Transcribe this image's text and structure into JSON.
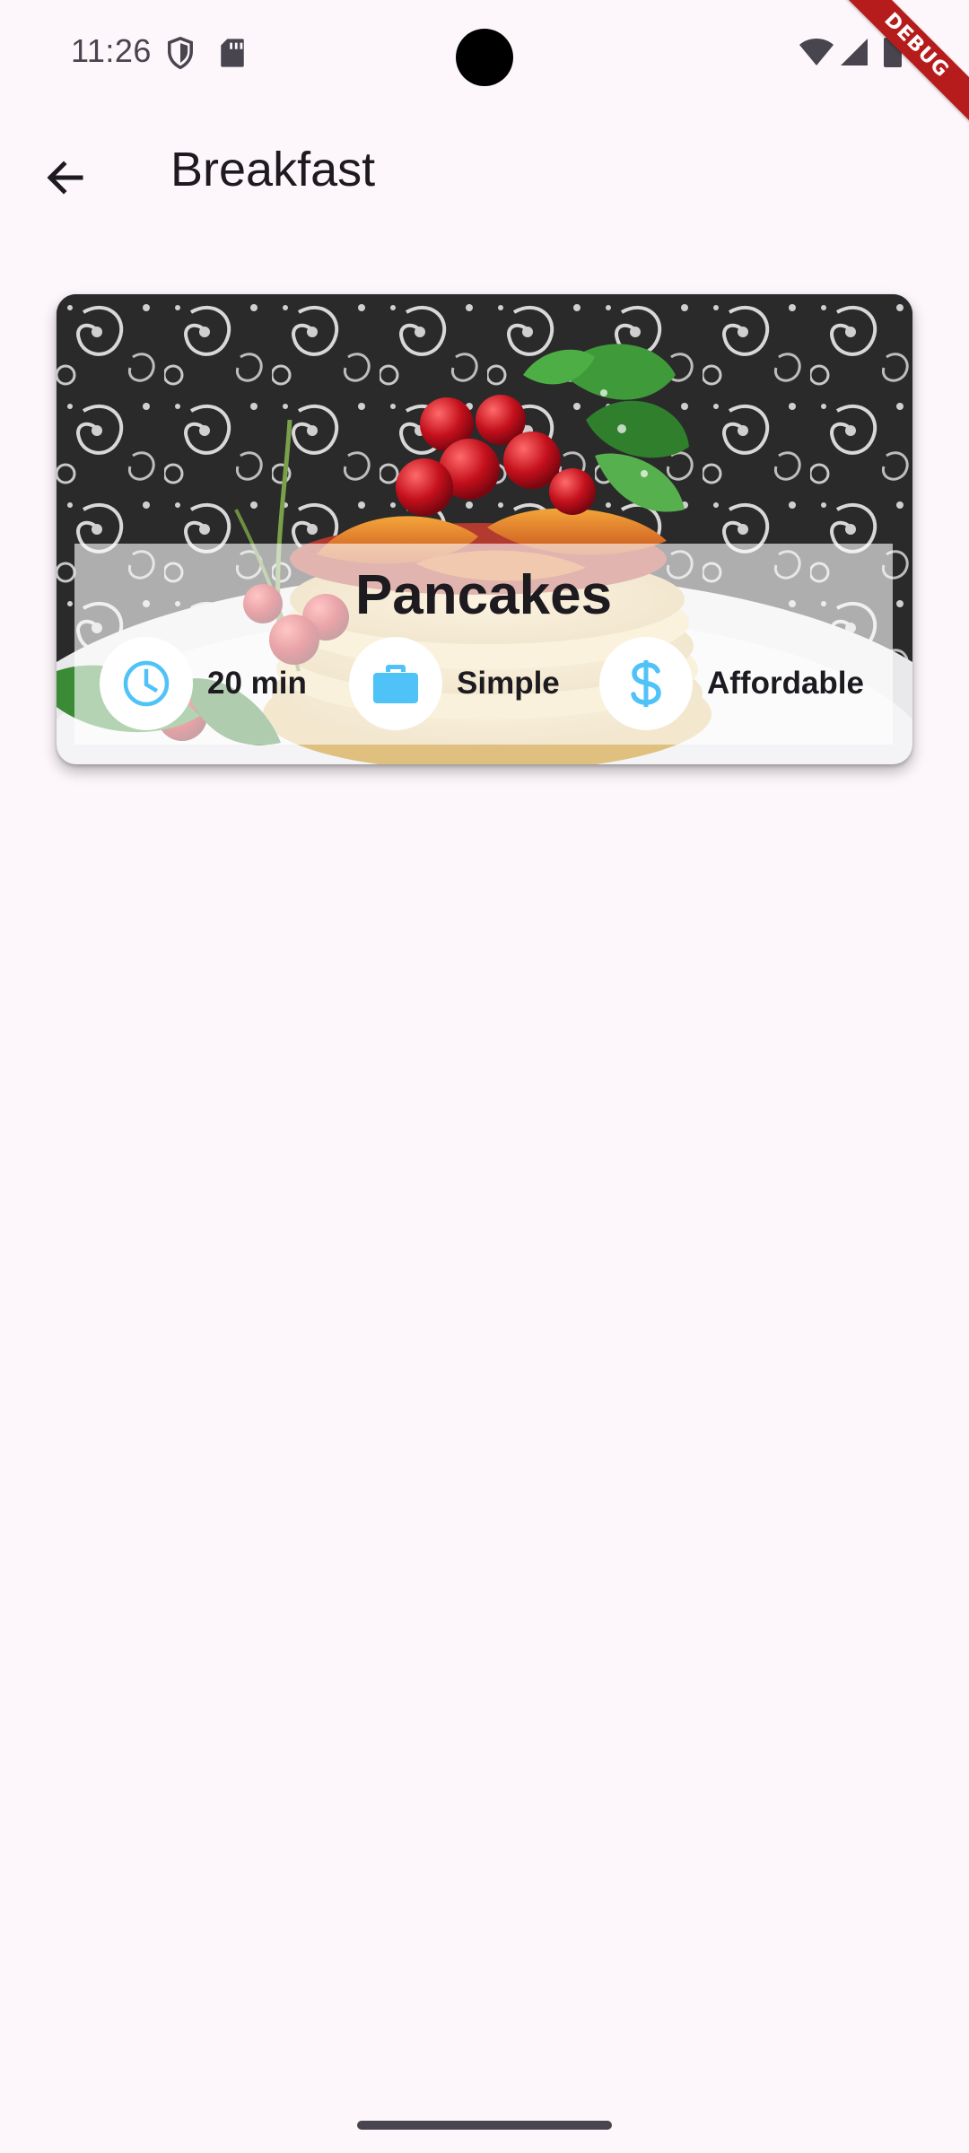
{
  "status_bar": {
    "time": "11:26",
    "debug_label": "DEBUG"
  },
  "app_bar": {
    "title": "Breakfast"
  },
  "meal": {
    "title": "Pancakes",
    "duration": "20 min",
    "complexity": "Simple",
    "affordability": "Affordable"
  },
  "icons": {
    "status": [
      "shield-icon",
      "sd-card-icon",
      "wifi-icon",
      "signal-icon",
      "battery-icon"
    ],
    "app_bar": [
      "back-arrow-icon"
    ],
    "meal_info": [
      "clock-icon",
      "briefcase-icon",
      "dollar-icon"
    ]
  },
  "colors": {
    "background": "#fdf7fc",
    "accent": "#4fc3f7",
    "text": "#1d1b20",
    "debug_banner": "#b71c1c"
  }
}
